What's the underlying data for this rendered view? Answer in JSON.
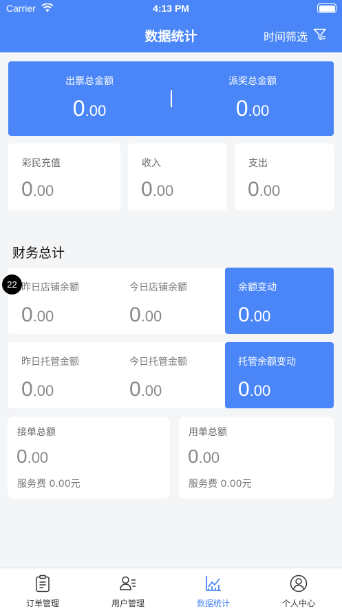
{
  "status_bar": {
    "carrier": "Carrier",
    "time": "4:13 PM"
  },
  "nav": {
    "title": "数据统计",
    "filter_label": "时间筛选"
  },
  "hero": {
    "left": {
      "label": "出票总金额",
      "int": "0",
      "dec": ".00"
    },
    "right": {
      "label": "派奖总金额",
      "int": "0",
      "dec": ".00"
    }
  },
  "small_cards": [
    {
      "label": "彩民充值",
      "int": "0",
      "dec": ".00"
    },
    {
      "label": "收入",
      "int": "0",
      "dec": ".00"
    },
    {
      "label": "支出",
      "int": "0",
      "dec": ".00"
    }
  ],
  "section_title": "财务总计",
  "badge": "22",
  "row1": [
    {
      "label": "昨日店铺余额",
      "int": "0",
      "dec": ".00"
    },
    {
      "label": "今日店铺余额",
      "int": "0",
      "dec": ".00"
    },
    {
      "label": "余额变动",
      "int": "0",
      "dec": ".00"
    }
  ],
  "row2": [
    {
      "label": "昨日托管金额",
      "int": "0",
      "dec": ".00"
    },
    {
      "label": "今日托管金额",
      "int": "0",
      "dec": ".00"
    },
    {
      "label": "托管余额变动",
      "int": "0",
      "dec": ".00"
    }
  ],
  "summary": [
    {
      "label": "接单总额",
      "int": "0",
      "dec": ".00",
      "fee": "服务费 0.00元"
    },
    {
      "label": "用单总额",
      "int": "0",
      "dec": ".00",
      "fee": "服务费 0.00元"
    }
  ],
  "tabs": [
    {
      "label": "订单管理",
      "icon": "clipboard-icon"
    },
    {
      "label": "用户管理",
      "icon": "user-list-icon"
    },
    {
      "label": "数据统计",
      "icon": "chart-icon"
    },
    {
      "label": "个人中心",
      "icon": "profile-icon"
    }
  ],
  "colors": {
    "primary": "#4a86f7",
    "background": "#f4f5f7"
  }
}
